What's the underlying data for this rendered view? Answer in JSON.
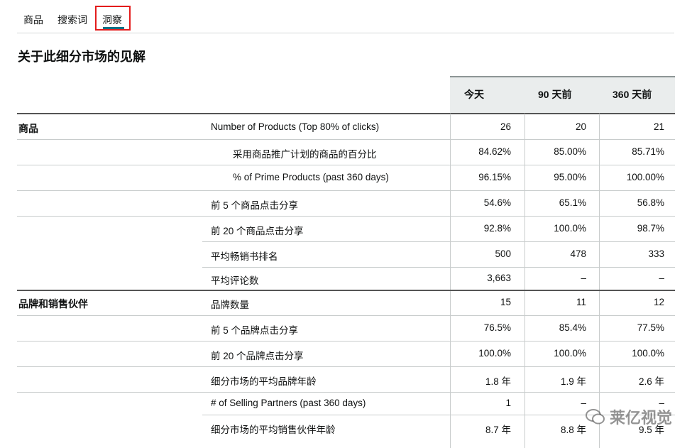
{
  "tabs": [
    {
      "label": "商品"
    },
    {
      "label": "搜索词"
    },
    {
      "label": "洞察"
    }
  ],
  "title": "关于此细分市场的见解",
  "columns": [
    "今天",
    "90 天前",
    "360 天前"
  ],
  "rows": [
    {
      "group": "商品",
      "metric": "Number of Products (Top 80% of clicks)",
      "values": [
        "26",
        "20",
        "21"
      ]
    },
    {
      "group": "",
      "metric": "采用商品推广计划的商品的百分比",
      "values": [
        "84.62%",
        "85.00%",
        "85.71%"
      ]
    },
    {
      "group": "",
      "metric": "% of Prime Products (past 360 days)",
      "values": [
        "96.15%",
        "95.00%",
        "100.00%"
      ]
    },
    {
      "group": "",
      "metric": "前 5 个商品点击分享",
      "values": [
        "54.6%",
        "65.1%",
        "56.8%"
      ]
    },
    {
      "group": "",
      "metric": "前 20 个商品点击分享",
      "values": [
        "92.8%",
        "100.0%",
        "98.7%"
      ]
    },
    {
      "group": "",
      "metric": "平均畅销书排名",
      "values": [
        "500",
        "478",
        "333"
      ]
    },
    {
      "group": "",
      "metric": "平均评论数",
      "values": [
        "3,663",
        "–",
        "–"
      ]
    },
    {
      "group": "品牌和销售伙伴",
      "metric": "品牌数量",
      "values": [
        "15",
        "11",
        "12"
      ]
    },
    {
      "group": "",
      "metric": "前 5 个品牌点击分享",
      "values": [
        "76.5%",
        "85.4%",
        "77.5%"
      ]
    },
    {
      "group": "",
      "metric": "前 20 个品牌点击分享",
      "values": [
        "100.0%",
        "100.0%",
        "100.0%"
      ]
    },
    {
      "group": "",
      "metric": "细分市场的平均品牌年龄",
      "values": [
        "1.8 年",
        "1.9 年",
        "2.6 年"
      ]
    },
    {
      "group": "",
      "metric": "# of Selling Partners (past 360 days)",
      "values": [
        "1",
        "–",
        "–"
      ]
    },
    {
      "group": "",
      "metric": "细分市场的平均销售伙伴年龄",
      "values": [
        "8.7 年",
        "8.8 年",
        "9.5 年"
      ]
    }
  ],
  "watermark": {
    "text": "莱亿视觉",
    "icon": "wechat-icon"
  }
}
